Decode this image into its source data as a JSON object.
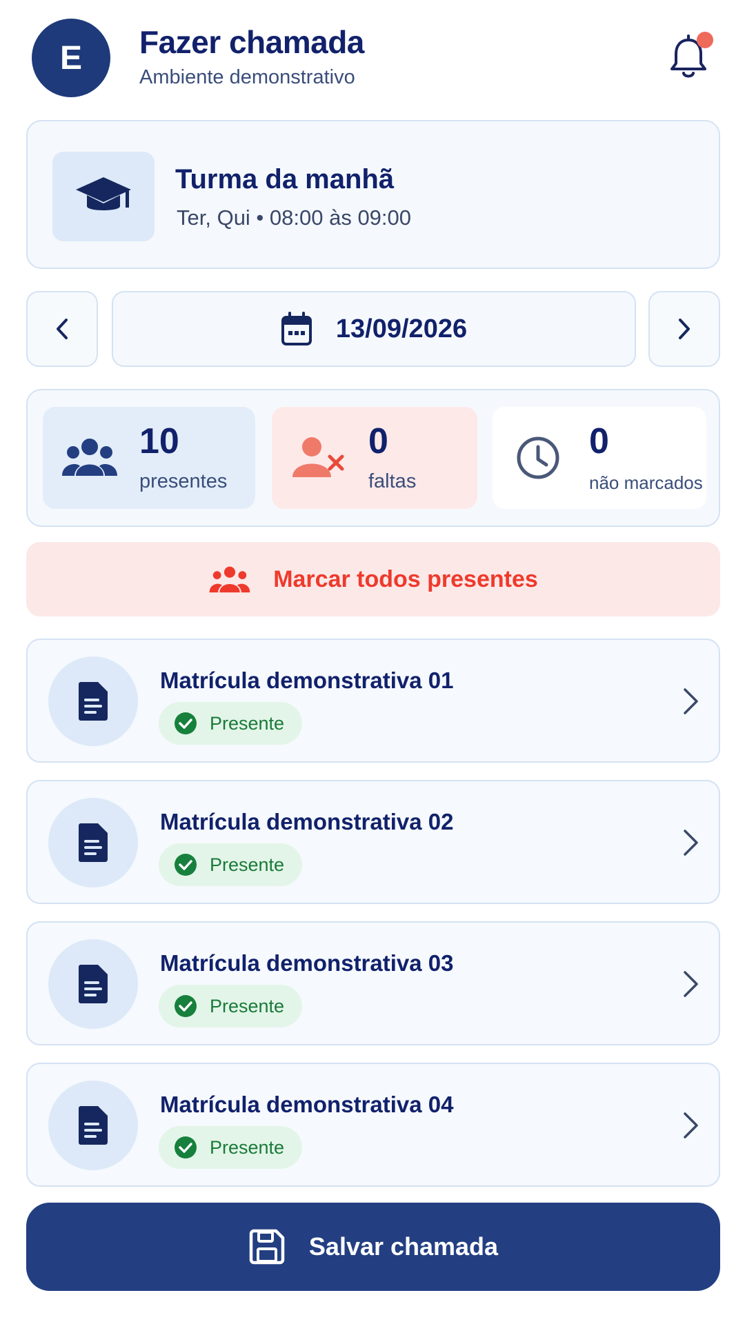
{
  "header": {
    "avatar_letter": "E",
    "title": "Fazer chamada",
    "subtitle": "Ambiente demonstrativo",
    "icon": "bell-icon",
    "has_notification": true
  },
  "class": {
    "icon": "graduation-cap-icon",
    "name": "Turma da manhã",
    "schedule": "Ter, Qui • 08:00 às 09:00"
  },
  "date_nav": {
    "prev_icon": "chevron-left-icon",
    "next_icon": "chevron-right-icon",
    "calendar_icon": "calendar-icon",
    "date": "13/09/2026"
  },
  "stats": {
    "present": {
      "value": "10",
      "label": "presentes",
      "icon": "users-icon"
    },
    "absent": {
      "value": "0",
      "label": "faltas",
      "icon": "user-x-icon"
    },
    "unmarked": {
      "value": "0",
      "label": "não marcados",
      "icon": "clock-icon"
    }
  },
  "mark_all": {
    "label": "Marcar todos presentes",
    "icon": "users-icon"
  },
  "students": [
    {
      "name": "Matrícula demonstrativa 01",
      "status": "Presente"
    },
    {
      "name": "Matrícula demonstrativa 02",
      "status": "Presente"
    },
    {
      "name": "Matrícula demonstrativa 03",
      "status": "Presente"
    },
    {
      "name": "Matrícula demonstrativa 04",
      "status": "Presente"
    }
  ],
  "save": {
    "label": "Salvar chamada",
    "icon": "save-icon"
  },
  "colors": {
    "primary": "#233f82",
    "accent_red": "#ee3a2c",
    "success": "#1a7a3a"
  }
}
